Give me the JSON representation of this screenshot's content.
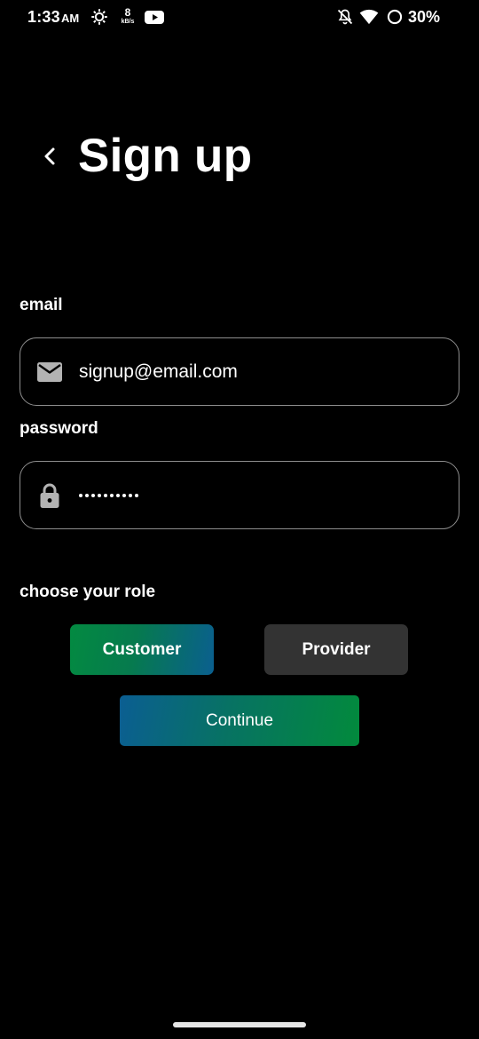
{
  "status_bar": {
    "time": "1:33",
    "ampm": "AM",
    "net_speed_value": "8",
    "net_speed_unit": "kB/s",
    "battery_percent": "30%",
    "icons": [
      "gear-icon",
      "youtube-icon",
      "bell-off-icon",
      "wifi-icon",
      "battery-ring-icon"
    ]
  },
  "header": {
    "back_icon": "chevron-left-icon",
    "title": "Sign up"
  },
  "form": {
    "email_label": "email",
    "email_value": "signup@email.com",
    "email_icon": "mail-icon",
    "password_label": "password",
    "password_masked_length": 10,
    "password_icon": "lock-icon",
    "role_label": "choose your role",
    "roles": [
      {
        "label": "Customer",
        "selected": true
      },
      {
        "label": "Provider",
        "selected": false
      }
    ],
    "continue_label": "Continue"
  },
  "colors": {
    "background": "#000000",
    "text": "#ffffff",
    "input_border": "#8e8e8e",
    "accent_green": "#028a3c",
    "accent_blue": "#0b5e92",
    "unselected_role": "#333333"
  }
}
